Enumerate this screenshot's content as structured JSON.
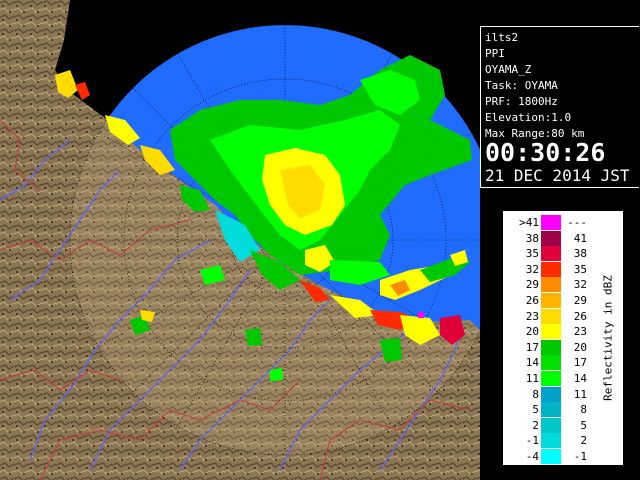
{
  "info": {
    "system": "ilts2",
    "mode": "PPI",
    "product": "OYAMA_Z",
    "task": "Task: OYAMA",
    "prf": "PRF: 1800Hz",
    "elevation": "Elevation:1.0",
    "max_range": "Max Range:80 km",
    "time": "00:30:26",
    "date": "21 DEC 2014 JST"
  },
  "legend": {
    "title": "Reflectivity in dBZ",
    "rows": [
      {
        "left": ">41",
        "right": "---",
        "color": "#ff00ff"
      },
      {
        "left": "38",
        "right": "41",
        "color": "#a0004a"
      },
      {
        "left": "35",
        "right": "38",
        "color": "#e0003a"
      },
      {
        "left": "32",
        "right": "35",
        "color": "#ff2a00"
      },
      {
        "left": "29",
        "right": "32",
        "color": "#ff8c00"
      },
      {
        "left": "26",
        "right": "29",
        "color": "#ffb400"
      },
      {
        "left": "23",
        "right": "26",
        "color": "#ffdc00"
      },
      {
        "left": "20",
        "right": "23",
        "color": "#ffff00"
      },
      {
        "left": "17",
        "right": "20",
        "color": "#00c800"
      },
      {
        "left": "14",
        "right": "17",
        "color": "#00e000"
      },
      {
        "left": "11",
        "right": "14",
        "color": "#00ff00"
      },
      {
        "left": "8",
        "right": "11",
        "color": "#00a0c8"
      },
      {
        "left": "5",
        "right": "8",
        "color": "#00b4c8"
      },
      {
        "left": "2",
        "right": "5",
        "color": "#00c8c8"
      },
      {
        "left": "-1",
        "right": "2",
        "color": "#00dcdc"
      },
      {
        "left": "-4",
        "right": "-1",
        "color": "#00ffff"
      }
    ]
  },
  "colors": {
    "sea": "#1f6cff",
    "terrain": "#8a7250",
    "rivers": "#5a64ff",
    "boundaries": "#c04040"
  }
}
